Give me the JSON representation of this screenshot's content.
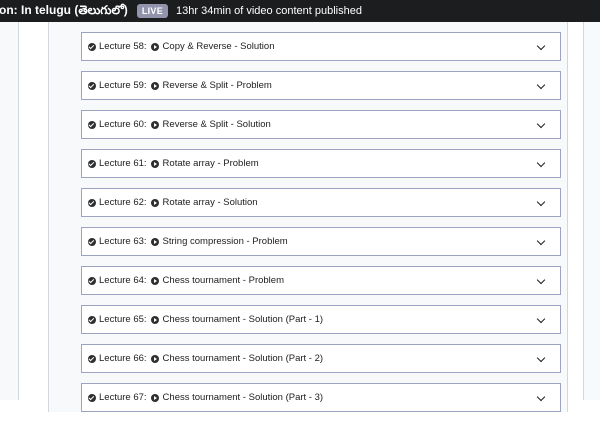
{
  "header": {
    "course_title": "on: In telugu (తెలుగులో)",
    "live_badge": "LIVE",
    "published_text": "13hr 34min of video content published"
  },
  "lectures": [
    {
      "number": "Lecture 58:",
      "title": "Copy & Reverse - Solution"
    },
    {
      "number": "Lecture 59:",
      "title": "Reverse & Split - Problem"
    },
    {
      "number": "Lecture 60:",
      "title": "Reverse & Split - Solution"
    },
    {
      "number": "Lecture 61:",
      "title": "Rotate array - Problem"
    },
    {
      "number": "Lecture 62:",
      "title": "Rotate array - Solution"
    },
    {
      "number": "Lecture 63:",
      "title": "String compression - Problem"
    },
    {
      "number": "Lecture 64:",
      "title": "Chess tournament - Problem"
    },
    {
      "number": "Lecture 65:",
      "title": "Chess tournament - Solution (Part - 1)"
    },
    {
      "number": "Lecture 66:",
      "title": "Chess tournament - Solution (Part - 2)"
    },
    {
      "number": "Lecture 67:",
      "title": "Chess tournament - Solution (Part - 3)"
    }
  ],
  "icons": {
    "completed": "check-circle-icon",
    "lecture_type": "play-circle-icon",
    "expand": "chevron-down-icon"
  },
  "colors": {
    "topbar_bg": "#1c1d1f",
    "live_badge_bg": "#9194ac",
    "lecture_border": "#9da3c0",
    "panel_bg": "#f7f9fa"
  }
}
